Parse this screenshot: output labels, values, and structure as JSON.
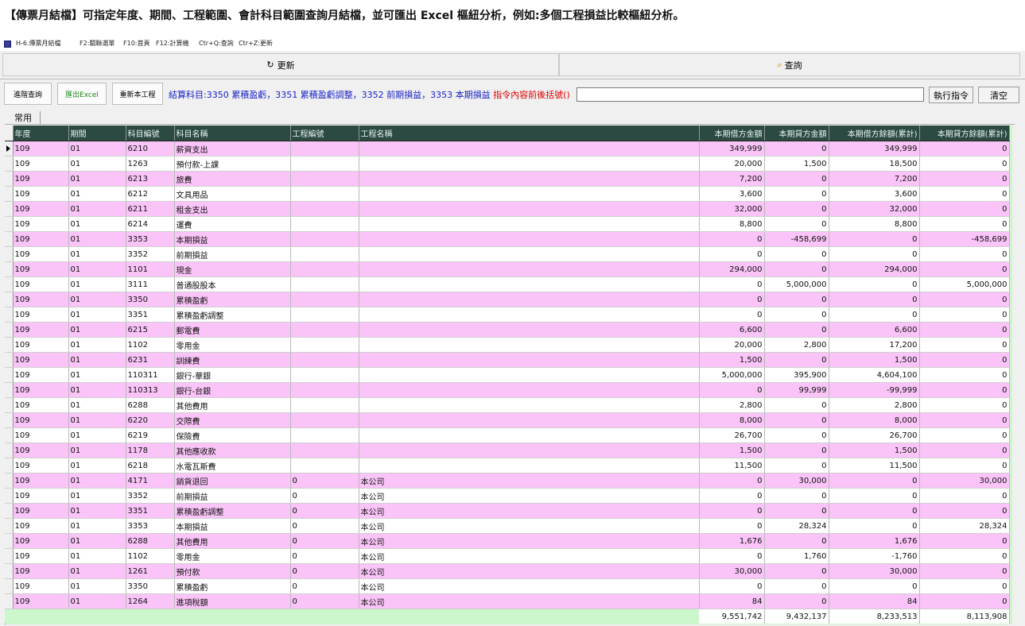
{
  "heading": "【傳票月結檔】可指定年度、期間、工程範圍、會計科目範圍查詢月結檔，並可匯出 Excel 樞紐分析，例如:多個工程損益比較樞紐分析。",
  "window": {
    "title": "H-6.傳票月結檔",
    "shortcuts": [
      "F2:關聯選單",
      "F10:首頁",
      "F12:計算機",
      "Ctr+Q:查詢",
      "Ctr+Z:更新"
    ]
  },
  "toolbar": {
    "refresh_label": "更新",
    "query_label": "查詢",
    "advanced_label": "進階查詢",
    "export_label": "匯出Excel",
    "reset_label": "重新本工程",
    "cmd_info_blue": "結算科目:3350 累積盈虧，3351 累積盈虧調整，3352 前期損益，3353 本期損益",
    "cmd_info_red": "指令內容前後括號()",
    "execute_label": "執行指令",
    "clear_label": "清空",
    "command_value": ""
  },
  "tab_label": "常用",
  "grid": {
    "columns": [
      "年度",
      "期間",
      "科目編號",
      "科目名稱",
      "工程編號",
      "工程名稱",
      "本期借方金額",
      "本期貸方金額",
      "本期借方餘額(累計)",
      "本期貸方餘額(累計)"
    ],
    "rows": [
      [
        "109",
        "01",
        "6210",
        "薪資支出",
        "",
        "",
        "349,999",
        "0",
        "349,999",
        "0"
      ],
      [
        "109",
        "01",
        "1263",
        "預付款-上課",
        "",
        "",
        "20,000",
        "1,500",
        "18,500",
        "0"
      ],
      [
        "109",
        "01",
        "6213",
        "旅費",
        "",
        "",
        "7,200",
        "0",
        "7,200",
        "0"
      ],
      [
        "109",
        "01",
        "6212",
        "文具用品",
        "",
        "",
        "3,600",
        "0",
        "3,600",
        "0"
      ],
      [
        "109",
        "01",
        "6211",
        "租金支出",
        "",
        "",
        "32,000",
        "0",
        "32,000",
        "0"
      ],
      [
        "109",
        "01",
        "6214",
        "運費",
        "",
        "",
        "8,800",
        "0",
        "8,800",
        "0"
      ],
      [
        "109",
        "01",
        "3353",
        "本期損益",
        "",
        "",
        "0",
        "-458,699",
        "0",
        "-458,699"
      ],
      [
        "109",
        "01",
        "3352",
        "前期損益",
        "",
        "",
        "0",
        "0",
        "0",
        "0"
      ],
      [
        "109",
        "01",
        "1101",
        "現金",
        "",
        "",
        "294,000",
        "0",
        "294,000",
        "0"
      ],
      [
        "109",
        "01",
        "3111",
        "普通股股本",
        "",
        "",
        "0",
        "5,000,000",
        "0",
        "5,000,000"
      ],
      [
        "109",
        "01",
        "3350",
        "累積盈虧",
        "",
        "",
        "0",
        "0",
        "0",
        "0"
      ],
      [
        "109",
        "01",
        "3351",
        "累積盈虧調整",
        "",
        "",
        "0",
        "0",
        "0",
        "0"
      ],
      [
        "109",
        "01",
        "6215",
        "郵電費",
        "",
        "",
        "6,600",
        "0",
        "6,600",
        "0"
      ],
      [
        "109",
        "01",
        "1102",
        "零用金",
        "",
        "",
        "20,000",
        "2,800",
        "17,200",
        "0"
      ],
      [
        "109",
        "01",
        "6231",
        "訓練費",
        "",
        "",
        "1,500",
        "0",
        "1,500",
        "0"
      ],
      [
        "109",
        "01",
        "110311",
        "銀行-華銀",
        "",
        "",
        "5,000,000",
        "395,900",
        "4,604,100",
        "0"
      ],
      [
        "109",
        "01",
        "110313",
        "銀行-台銀",
        "",
        "",
        "0",
        "99,999",
        "-99,999",
        "0"
      ],
      [
        "109",
        "01",
        "6288",
        "其他費用",
        "",
        "",
        "2,800",
        "0",
        "2,800",
        "0"
      ],
      [
        "109",
        "01",
        "6220",
        "交際費",
        "",
        "",
        "8,000",
        "0",
        "8,000",
        "0"
      ],
      [
        "109",
        "01",
        "6219",
        "保險費",
        "",
        "",
        "26,700",
        "0",
        "26,700",
        "0"
      ],
      [
        "109",
        "01",
        "1178",
        "其他應收款",
        "",
        "",
        "1,500",
        "0",
        "1,500",
        "0"
      ],
      [
        "109",
        "01",
        "6218",
        "水電瓦斯費",
        "",
        "",
        "11,500",
        "0",
        "11,500",
        "0"
      ],
      [
        "109",
        "01",
        "4171",
        "銷貨退回",
        "0",
        "本公司",
        "0",
        "30,000",
        "0",
        "30,000"
      ],
      [
        "109",
        "01",
        "3352",
        "前期損益",
        "0",
        "本公司",
        "0",
        "0",
        "0",
        "0"
      ],
      [
        "109",
        "01",
        "3351",
        "累積盈虧調整",
        "0",
        "本公司",
        "0",
        "0",
        "0",
        "0"
      ],
      [
        "109",
        "01",
        "3353",
        "本期損益",
        "0",
        "本公司",
        "0",
        "28,324",
        "0",
        "28,324"
      ],
      [
        "109",
        "01",
        "6288",
        "其他費用",
        "0",
        "本公司",
        "1,676",
        "0",
        "1,676",
        "0"
      ],
      [
        "109",
        "01",
        "1102",
        "零用金",
        "0",
        "本公司",
        "0",
        "1,760",
        "-1,760",
        "0"
      ],
      [
        "109",
        "01",
        "1261",
        "預付款",
        "0",
        "本公司",
        "30,000",
        "0",
        "30,000",
        "0"
      ],
      [
        "109",
        "01",
        "3350",
        "累積盈虧",
        "0",
        "本公司",
        "0",
        "0",
        "0",
        "0"
      ],
      [
        "109",
        "01",
        "1264",
        "進項稅額",
        "0",
        "本公司",
        "84",
        "0",
        "84",
        "0"
      ]
    ],
    "totals": [
      "9,551,742",
      "9,432,137",
      "8,233,513",
      "8,113,908"
    ]
  },
  "colors": {
    "row_pink": "#fac4f8",
    "row_white": "#ffffff",
    "header_bg": "#2c4a42",
    "footer_green": "#ccf7cc",
    "info_blue": "#1a22c8",
    "info_red": "#e00000"
  }
}
